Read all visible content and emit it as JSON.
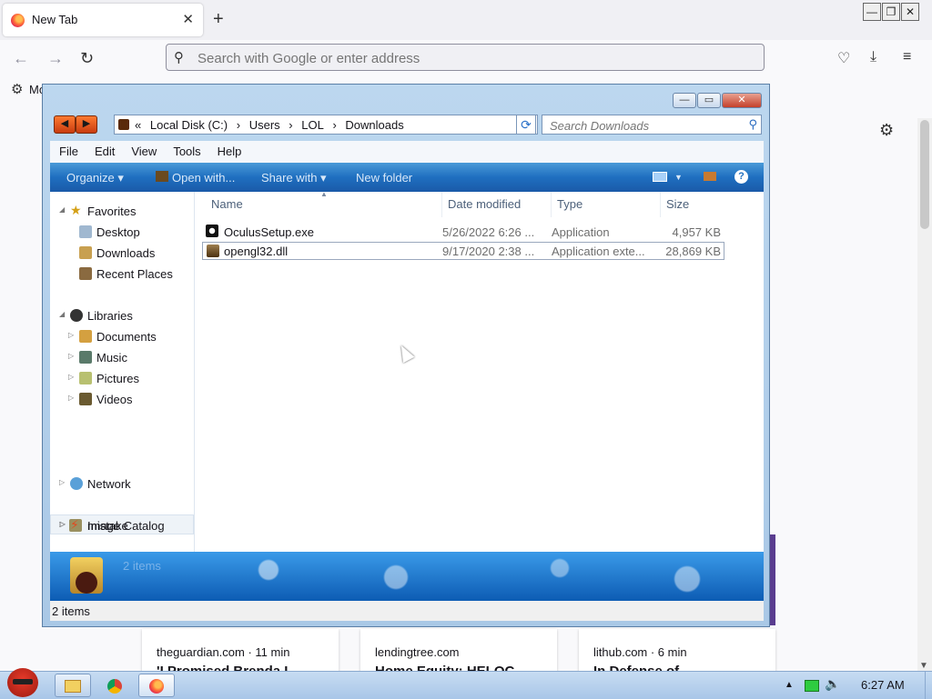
{
  "browser": {
    "tab_title": "New Tab",
    "tab_close": "✕",
    "new_tab": "+",
    "url_placeholder": "Search with Google or enter address",
    "bookmarks_label": "Mo",
    "window_controls": [
      "—",
      "❐",
      "✕"
    ]
  },
  "news_cards": [
    {
      "source": "theguardian.com · 11 min",
      "headline": "'I Promised Brenda I"
    },
    {
      "source": "lendingtree.com",
      "headline": "Home Equity: HELOC"
    },
    {
      "source": "lithub.com · 6 min",
      "headline": "In Defense of"
    }
  ],
  "explorer": {
    "controls": {
      "minimize": "—",
      "maximize": "▭",
      "close": "✕"
    },
    "nav_arrows": [
      "◀",
      "▶"
    ],
    "breadcrumb": {
      "prefix": "«",
      "parts": [
        "Local Disk (C:)",
        "›",
        "Users",
        "›",
        "LOL",
        "›",
        "Downloads"
      ]
    },
    "search_placeholder": "Search Downloads",
    "menu": [
      "File",
      "Edit",
      "View",
      "Tools",
      "Help"
    ],
    "toolbar": {
      "organize": "Organize ▾",
      "open_with": "Open with...",
      "share_with": "Share with ▾",
      "new_folder": "New folder",
      "help": "?"
    },
    "nav_pane": {
      "favorites": "Favorites",
      "favorites_items": [
        "Desktop",
        "Downloads",
        "Recent Places"
      ],
      "libraries": "Libraries",
      "libraries_items": [
        "Documents",
        "Music",
        "Pictures",
        "Videos"
      ],
      "mistake": "mistake",
      "network": "Network",
      "image_catalog": "Image Catalog"
    },
    "columns": [
      "Name",
      "Date modified",
      "Type",
      "Size"
    ],
    "files": [
      {
        "name": "OculusSetup.exe",
        "date": "5/26/2022 6:26 ...",
        "type": "Application",
        "size": "4,957 KB"
      },
      {
        "name": "opengl32.dll",
        "date": "9/17/2020 2:38 ...",
        "type": "Application exte...",
        "size": "28,869 KB"
      }
    ],
    "details_count": "2 items",
    "status": "2 items"
  },
  "taskbar": {
    "clock": "6:27 AM"
  },
  "colors": {
    "toolbar_blue": "#1f6fc0",
    "close_red": "#c4402a",
    "accent_orange": "#ff7139"
  }
}
